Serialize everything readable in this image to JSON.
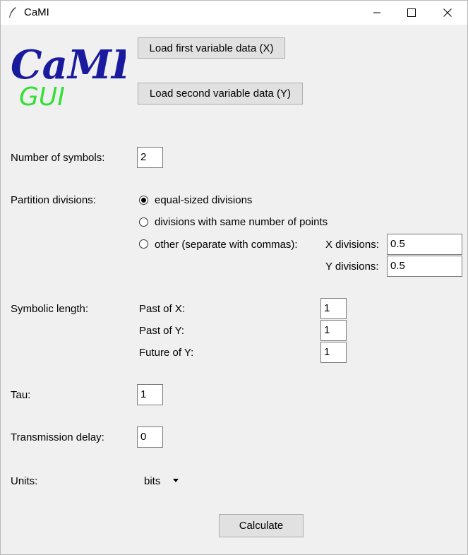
{
  "window": {
    "title": "CaMI"
  },
  "logo": {
    "text_main": "CaMI",
    "text_sub": "GUI"
  },
  "buttons": {
    "load_x": "Load first variable data (X)",
    "load_y": "Load second variable data (Y)",
    "calculate": "Calculate"
  },
  "symbols": {
    "label": "Number of symbols:",
    "value": "2"
  },
  "partition": {
    "label": "Partition divisions:",
    "options": [
      {
        "label": "equal-sized divisions",
        "checked": true
      },
      {
        "label": "divisions with same number of points",
        "checked": false
      },
      {
        "label": "other (separate with commas):",
        "checked": false
      }
    ],
    "x_label": "X divisions:",
    "x_value": "0.5",
    "y_label": "Y divisions:",
    "y_value": "0.5"
  },
  "symbolic_length": {
    "label": "Symbolic length:",
    "past_x_label": "Past of X:",
    "past_x_value": "1",
    "past_y_label": "Past of Y:",
    "past_y_value": "1",
    "future_y_label": "Future of Y:",
    "future_y_value": "1"
  },
  "tau": {
    "label": "Tau:",
    "value": "1"
  },
  "delay": {
    "label": "Transmission delay:",
    "value": "0"
  },
  "units": {
    "label": "Units:",
    "selected": "bits"
  },
  "colors": {
    "logo_main": "#1a1a9e",
    "logo_sub": "#33e033"
  }
}
